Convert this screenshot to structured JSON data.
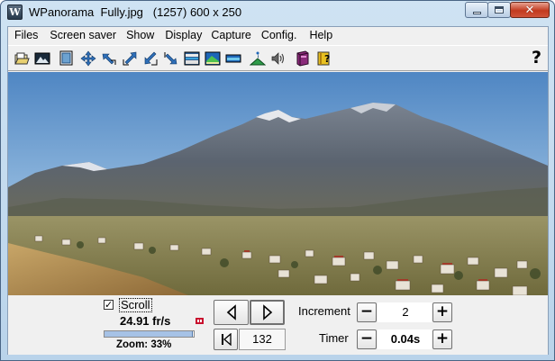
{
  "window": {
    "title": "WPanorama  Fully.jpg   (1257) 600 x 250",
    "app_icon_letter": "W",
    "minimize_glyph": "",
    "close_glyph": "✕"
  },
  "menu": [
    "Files",
    "Screen saver",
    "Show",
    "Display",
    "Capture",
    "Config.",
    "Help"
  ],
  "toolbar": {
    "icons": [
      "open-file-icon",
      "picture-icon",
      "fit-window-icon",
      "move-arrows-icon",
      "shrink-left-icon",
      "expand-up-right-icon",
      "shrink-down-left-icon",
      "expand-down-right-icon",
      "landscape-view-icon",
      "landscape-view-2-icon",
      "landscape-flat-icon",
      "mountain-person-icon",
      "speaker-icon",
      "book-icon",
      "help-book-icon",
      "help-icon"
    ],
    "help_label": "?"
  },
  "controls": {
    "scroll_label": "Scroll",
    "scroll_checked": true,
    "check_glyph": "✓",
    "fps": "24.91 fr/s",
    "zoom": "Zoom: 33%",
    "zoom_fraction": 0.33,
    "frame_number": "132",
    "increment_label": "Increment",
    "increment_value": "2",
    "timer_label": "Timer",
    "timer_value": "0.04s",
    "minus": "−",
    "plus": "+"
  }
}
